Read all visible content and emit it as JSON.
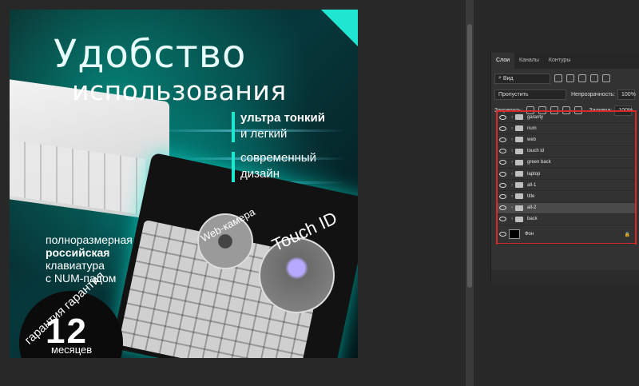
{
  "canvas": {
    "title_line1": "Удобство",
    "title_line2": "использования",
    "feature1_bold": "ультра тонкий",
    "feature1_rest": "и легкий",
    "feature2_line1": "современный",
    "feature2_line2": "дизайн",
    "webcam_label": "Web-камера",
    "touch_label": "Touch ID",
    "keyboard_line1": "полноразмерная",
    "keyboard_bold": "российская",
    "keyboard_line3": "клавиатура",
    "keyboard_line4": "с NUM-падом",
    "warranty_arc": "гарантия гарантия",
    "warranty_number": "12",
    "warranty_unit": "месяцев"
  },
  "panel": {
    "tabs": [
      "Слои",
      "Каналы",
      "Контуры"
    ],
    "filter_label": "Вид",
    "blend_mode": "Пропустить",
    "opacity_label": "Непрозрачность:",
    "opacity_value": "100%",
    "lock_label": "Закрепить:",
    "fill_label": "Заливка:",
    "fill_value": "100%",
    "layers": [
      {
        "name": "garanty"
      },
      {
        "name": "num"
      },
      {
        "name": "web"
      },
      {
        "name": "touch id"
      },
      {
        "name": "green back"
      },
      {
        "name": "laptop"
      },
      {
        "name": "all-1"
      },
      {
        "name": "title"
      },
      {
        "name": "all-2"
      },
      {
        "name": "back"
      },
      {
        "name": "Фон"
      }
    ]
  },
  "colors": {
    "accent_teal": "#1fe6d1",
    "highlight_border": "#d62b2b",
    "workspace": "#282828"
  }
}
